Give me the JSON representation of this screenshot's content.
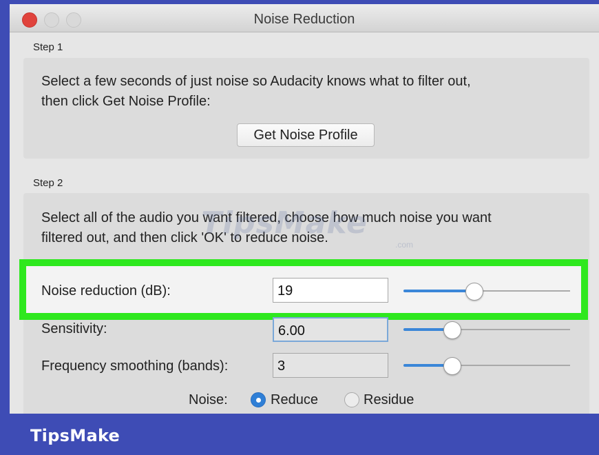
{
  "window": {
    "title": "Noise Reduction"
  },
  "step1": {
    "label": "Step 1",
    "description_line1": "Select a few seconds of just noise so Audacity knows what to filter out,",
    "description_line2": "then click Get Noise Profile:",
    "button_label": "Get Noise Profile"
  },
  "step2": {
    "label": "Step 2",
    "description_line1": "Select all of the audio you want filtered, choose how much noise you want",
    "description_line2": "filtered out, and then click 'OK' to reduce noise."
  },
  "controls": {
    "noise_reduction": {
      "label": "Noise reduction (dB):",
      "value": "19",
      "slider_fraction": 0.42
    },
    "sensitivity": {
      "label": "Sensitivity:",
      "value": "6.00",
      "slider_fraction": 0.29
    },
    "frequency_smoothing": {
      "label": "Frequency smoothing (bands):",
      "value": "3",
      "slider_fraction": 0.29
    },
    "noise_mode": {
      "label": "Noise:",
      "options": [
        "Reduce",
        "Residue"
      ],
      "selected": "Reduce"
    }
  },
  "watermark": {
    "text": "TipsMake",
    "suffix": ".com"
  },
  "footer": {
    "brand": "TipsMake"
  },
  "colors": {
    "frame": "#3e4cb5",
    "highlight": "#2ee81e",
    "accent": "#2f7fd6"
  }
}
